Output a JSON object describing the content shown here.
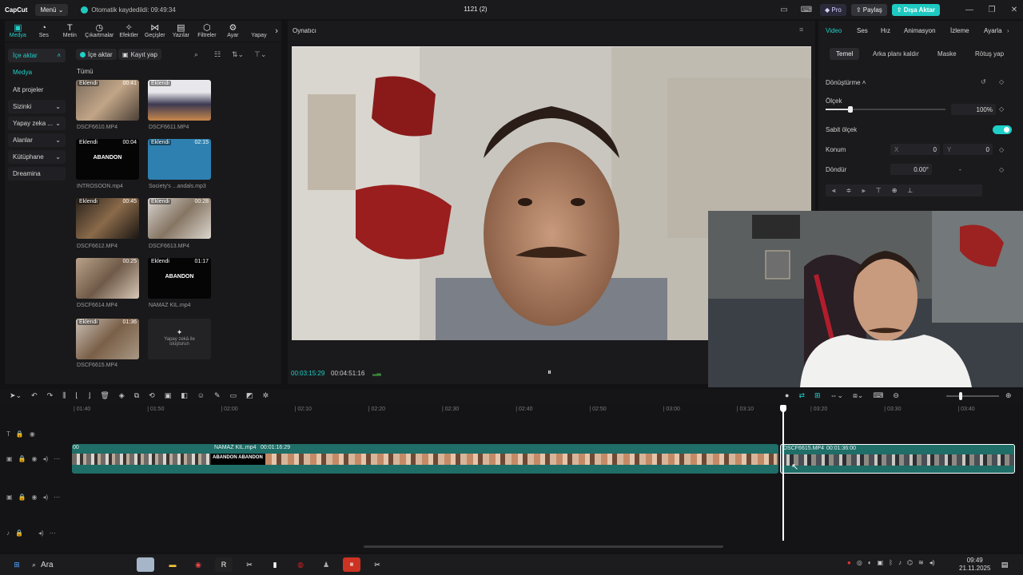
{
  "titlebar": {
    "logo": "CapCut",
    "menu": "Menü",
    "autosave": "Otomatik kaydedildi: 09:49:34",
    "project_title": "1121 (2)",
    "pro": "Pro",
    "share": "Paylaş",
    "export": "Dışa Aktar"
  },
  "left_tabs": [
    "Medya",
    "Ses",
    "Metin",
    "Çıkartmalar",
    "Efektler",
    "Geçişler",
    "Yazılar",
    "Filtreler",
    "Ayar",
    "Yapay"
  ],
  "sidenav": {
    "import": "İçe aktar",
    "media": "Medya",
    "sub_projects": "Alt projeler",
    "yours": "Sizinki",
    "ai": "Yapay zeka ...",
    "spaces": "Alanlar",
    "library": "Kütüphane",
    "dreamina": "Dreamina"
  },
  "media": {
    "import_btn": "İçe aktar",
    "record_btn": "Kayıt yap",
    "section": "Tümü",
    "added": "Eklendi",
    "ai_create": "Yapay zekâ ile oluşturun",
    "items": [
      {
        "name": "DSCF6610.MP4",
        "duration": "00:41",
        "badge": "Eklendi"
      },
      {
        "name": "DSCF6611.MP4",
        "duration": "",
        "badge": "Eklendi"
      },
      {
        "name": "INTROSOON.mp4",
        "duration": "00:04",
        "badge": "Eklendi",
        "text": "ABANDON"
      },
      {
        "name": "Society's ...andals.mp3",
        "duration": "02:15",
        "badge": "Eklendi"
      },
      {
        "name": "DSCF6612.MP4",
        "duration": "00:45",
        "badge": "Eklendi"
      },
      {
        "name": "DSCF6613.MP4",
        "duration": "00:28",
        "badge": "Eklendi"
      },
      {
        "name": "DSCF6614.MP4",
        "duration": "00:25",
        "badge": ""
      },
      {
        "name": "NAMAZ KIL.mp4",
        "duration": "01:17",
        "badge": "Eklendi",
        "text": "ABANDON"
      },
      {
        "name": "DSCF6615.MP4",
        "duration": "01:36",
        "badge": "Eklendi"
      }
    ]
  },
  "player": {
    "title": "Oynatıcı",
    "current_time": "00:03:15:29",
    "total_time": "00:04:51:16"
  },
  "props": {
    "tabs": [
      "Video",
      "Ses",
      "Hız",
      "Animasyon",
      "İzleme",
      "Ayarla"
    ],
    "subtabs": [
      "Temel",
      "Arka planı kaldır",
      "Maske",
      "Rötuş yap"
    ],
    "transform": "Dönüştürme",
    "scale_label": "Ölçek",
    "scale_value": "100%",
    "fixed_scale": "Sabit ölçek",
    "position": "Konum",
    "x_label": "X",
    "x_value": "0",
    "y_label": "Y",
    "y_value": "0",
    "rotate": "Döndür",
    "rotate_value": "0.00°",
    "rotate_extra": "-"
  },
  "timeline": {
    "ticks": [
      "01:40",
      "01:50",
      "02:00",
      "02:10",
      "02:20",
      "02:30",
      "02:40",
      "02:50",
      "03:00",
      "03:10",
      "03:20",
      "03:30",
      "03:40"
    ],
    "clip_start_label": "00",
    "clip1_name": "NAMAZ KIL.mp4",
    "clip1_duration": "00:01:16:29",
    "clip1_text": "ABANDON ABANDON",
    "clip2_name": "DSCF6615.MP4",
    "clip2_duration": "00:01:36:00"
  },
  "taskbar": {
    "search": "Ara",
    "time": "09:49",
    "date": "21.11.2025"
  },
  "colors": {
    "accent": "#1ed0c8",
    "clip": "#1f6e68"
  }
}
